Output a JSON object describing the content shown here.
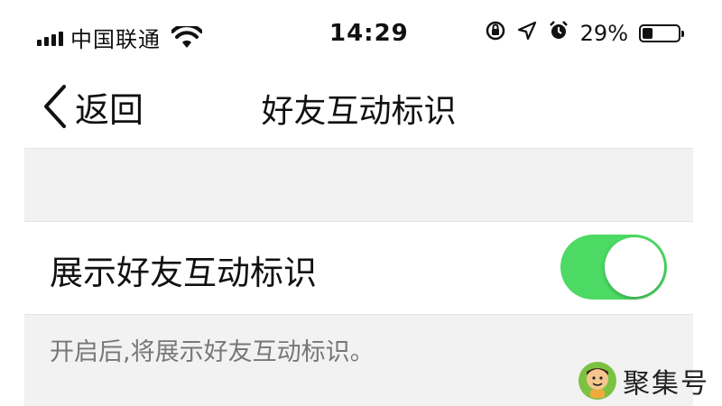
{
  "status_bar": {
    "carrier": "中国联通",
    "time": "14:29",
    "battery_percent": "29%",
    "battery_level": 0.29,
    "icons": [
      "signal-bars-icon",
      "wifi-icon",
      "rotation-lock-icon",
      "location-arrow-icon",
      "alarm-icon",
      "battery-icon"
    ]
  },
  "nav": {
    "back_label": "返回",
    "title": "好友互动标识"
  },
  "setting": {
    "label": "展示好友互动标识",
    "enabled": true,
    "toggle_color": "#4cd964"
  },
  "footnote": "开启后,将展示好友互动标识。",
  "watermark": {
    "text": "聚集号"
  }
}
